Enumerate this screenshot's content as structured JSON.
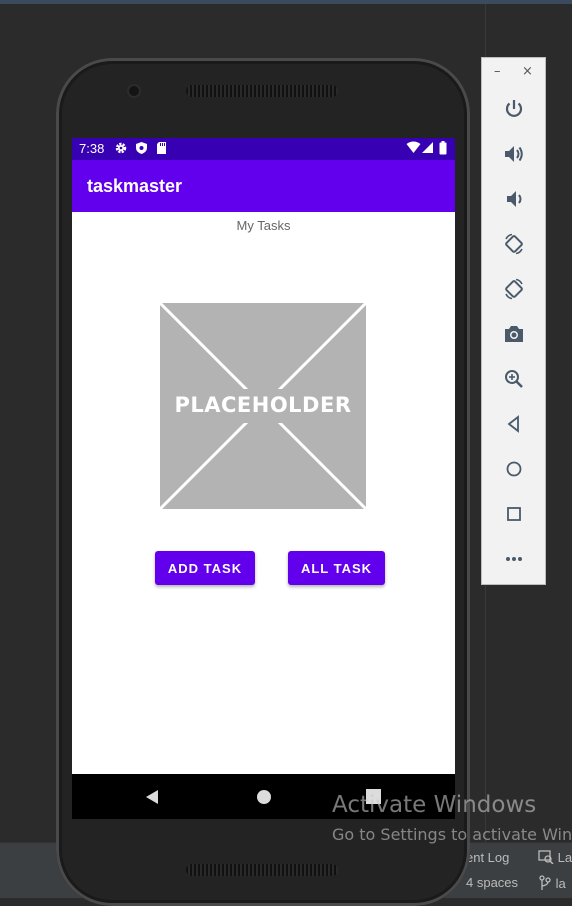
{
  "device": {
    "status_time": "7:38",
    "app_title": "taskmaster",
    "screen_title": "My Tasks",
    "placeholder_label": "PLACEHOLDER",
    "buttons": {
      "add_task": "ADD TASK",
      "all_task": "ALL TASK"
    }
  },
  "emulator_controls": {
    "minimize": "–",
    "close": "×",
    "items": [
      "power-icon",
      "volume-up-icon",
      "volume-down-icon",
      "rotate-left-icon",
      "rotate-right-icon",
      "screenshot-icon",
      "zoom-icon",
      "back-icon",
      "home-icon",
      "overview-icon",
      "more-icon"
    ]
  },
  "ide_status": {
    "event_log": "ent Log",
    "la_1": "La",
    "indent": "4 spaces",
    "branch": "la"
  },
  "watermark": {
    "line1": "Activate Windows",
    "line2": "Go to Settings to activate Wind"
  },
  "colors": {
    "primary": "#6200ee",
    "primary_dark": "#3700b3",
    "ide_bg": "#2b2b2b"
  }
}
